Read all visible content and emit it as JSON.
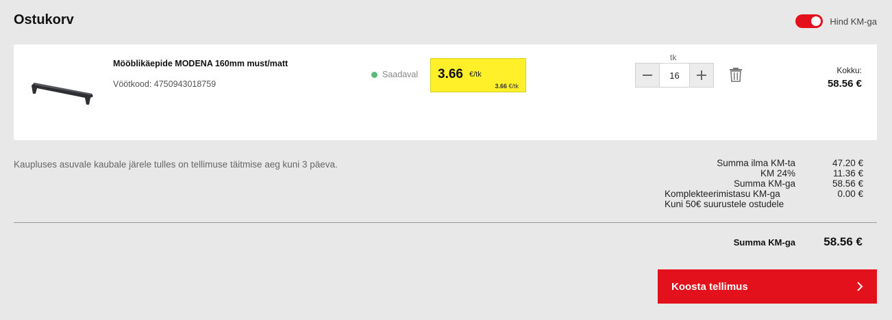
{
  "header": {
    "title": "Ostukorv",
    "vat_toggle_label": "Hind KM-ga",
    "vat_toggle_on": true
  },
  "cart_item": {
    "name": "Mööblikäepide MODENA 160mm must/matt",
    "barcode_label": "Vöötkood:",
    "barcode": "4750943018759",
    "availability": "Saadaval",
    "price": "3.66",
    "price_unit": "€/tk",
    "price_sub_value": "3.66",
    "price_sub_unit": "€/tk",
    "quantity_label": "tk",
    "quantity": "16",
    "total_label": "Kokku:",
    "total": "58.56 €"
  },
  "notice": "Kaupluses asuvale kaubale järele tulles on tellimuse täitmise aeg kuni 3 päeva.",
  "summary": {
    "rows": [
      {
        "label": "Summa ilma KM-ta",
        "value": "47.20 €"
      },
      {
        "label": "KM 24%",
        "value": "11.36 €"
      },
      {
        "label": "Summa KM-ga",
        "value": "58.56 €"
      },
      {
        "label": "Komplekteerimistasu KM-ga",
        "label2": "Kuni 50€ suurustele ostudele",
        "value": "0.00 €"
      }
    ],
    "grand_label": "Summa KM-ga",
    "grand_value": "58.56 €"
  },
  "checkout": {
    "label": "Koosta tellimus"
  },
  "colors": {
    "accent": "#e3111c",
    "price_highlight": "#fff02a",
    "available": "#5cb87a",
    "background": "#e8e8e9"
  },
  "icons": {
    "minus": "minus-icon",
    "plus": "plus-icon",
    "trash": "trash-icon",
    "chevron": "chevron-right-icon"
  }
}
